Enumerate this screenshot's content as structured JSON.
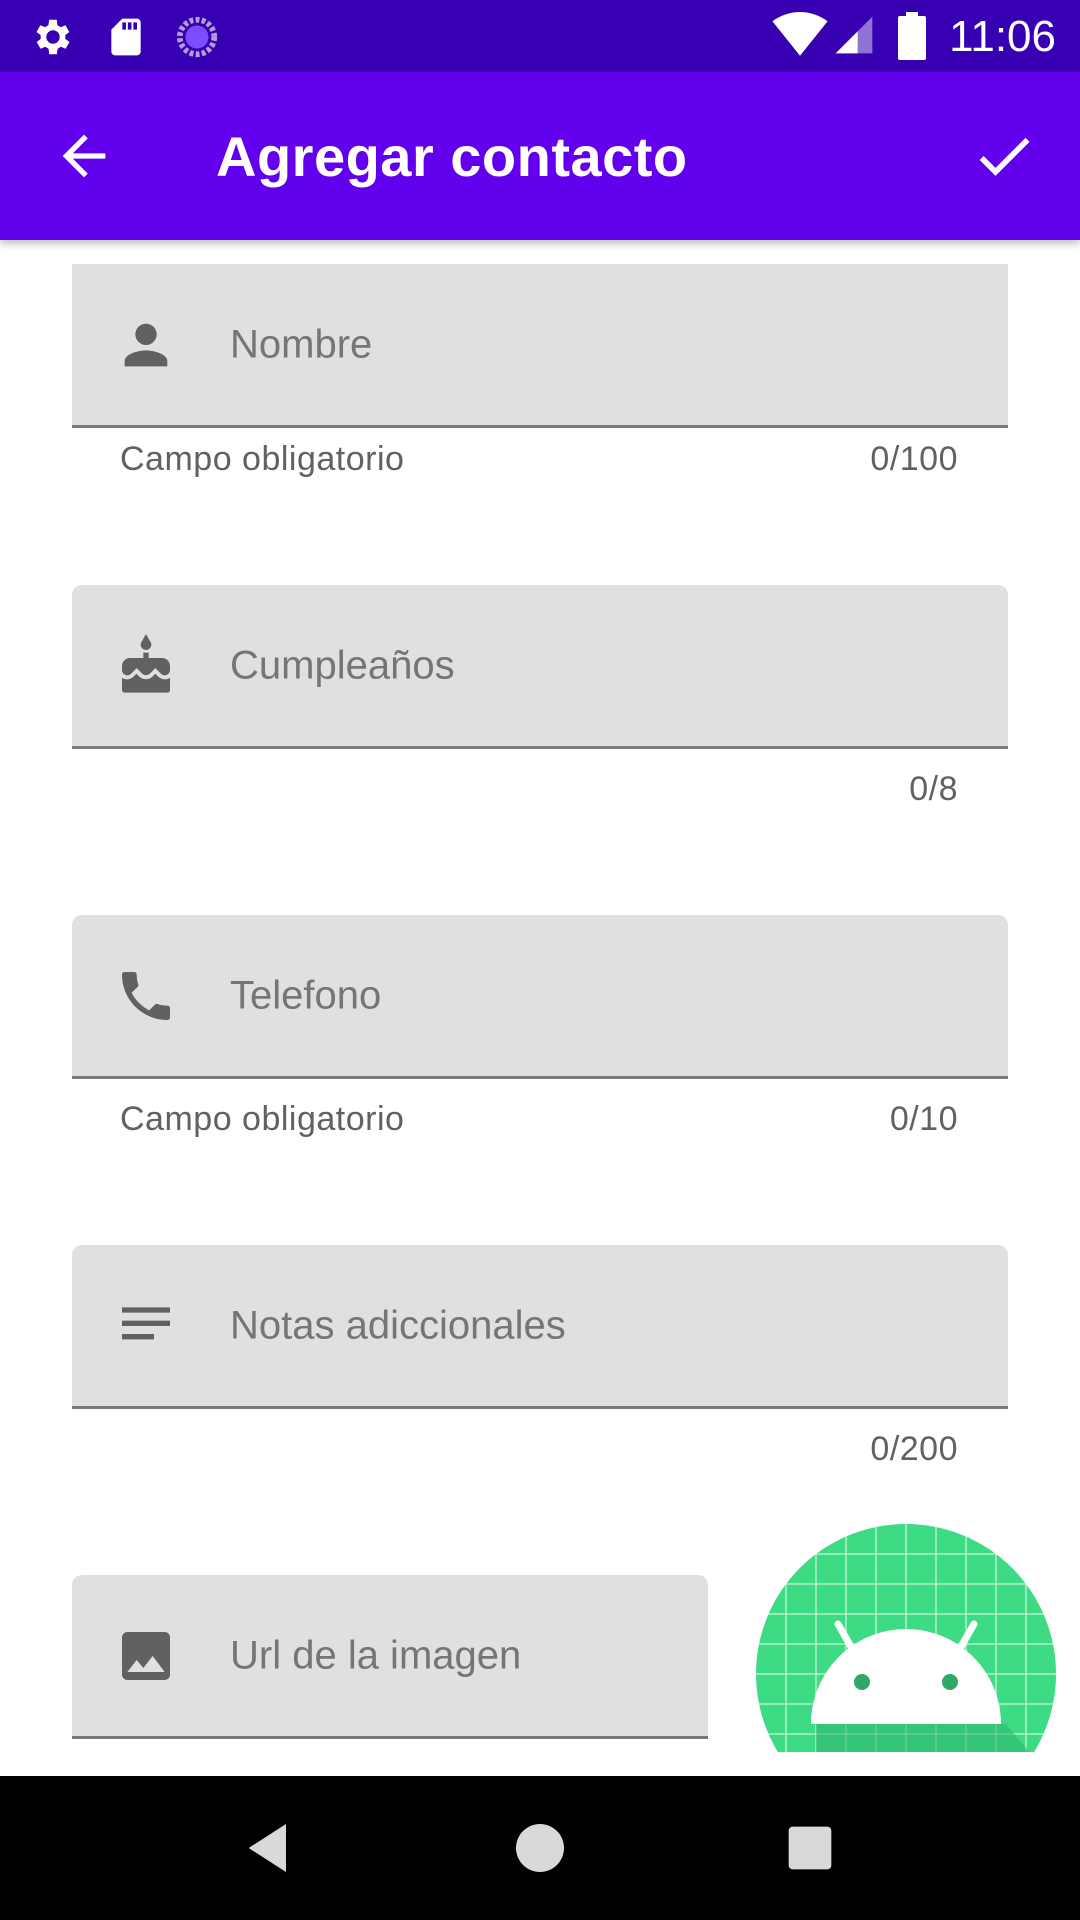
{
  "status_bar": {
    "time": "11:06",
    "icons": [
      "settings-icon",
      "sd-card-icon",
      "sync-icon",
      "wifi-icon",
      "signal-icon",
      "battery-icon"
    ]
  },
  "app_bar": {
    "title": "Agregar contacto",
    "back_icon": "arrow-back-icon",
    "confirm_icon": "check-icon"
  },
  "form": {
    "name": {
      "placeholder": "Nombre",
      "value": "",
      "helper": "Campo obligatorio",
      "counter": "0/100",
      "icon": "person-icon"
    },
    "birthday": {
      "placeholder": "Cumpleaños",
      "value": "",
      "helper": "",
      "counter": "0/8",
      "icon": "cake-icon"
    },
    "phone": {
      "placeholder": "Telefono",
      "value": "",
      "helper": "Campo obligatorio",
      "counter": "0/10",
      "icon": "phone-icon"
    },
    "notes": {
      "placeholder": "Notas adiccionales",
      "value": "",
      "helper": "",
      "counter": "0/200",
      "icon": "notes-icon"
    },
    "image_url": {
      "placeholder": "Url de la imagen",
      "value": "",
      "icon": "image-icon"
    }
  },
  "avatar": {
    "icon": "android-avatar-icon",
    "color": "#3ddc84"
  },
  "nav_bar": {
    "icons": [
      "nav-back-icon",
      "nav-home-icon",
      "nav-recents-icon"
    ]
  },
  "colors": {
    "status_bar": "#3700b3",
    "app_bar": "#6200ee",
    "field_bg": "#e0e0e0"
  }
}
